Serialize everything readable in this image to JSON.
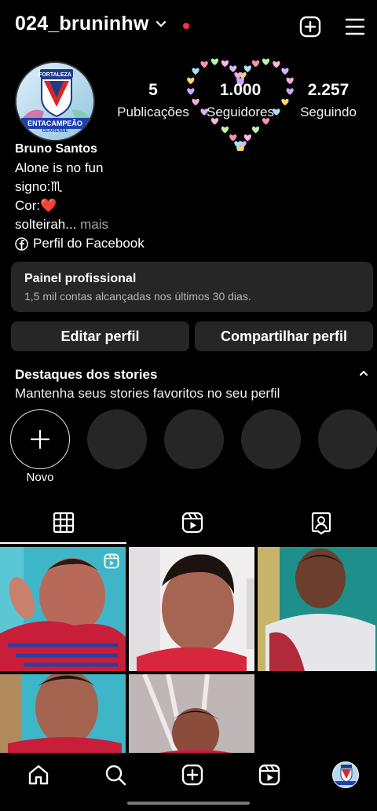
{
  "header": {
    "username": "024_bruninhw"
  },
  "avatar": {
    "badge_top_text": "FORTALEZA",
    "badge_bottom_text": "ENTACAMPEÃO",
    "badge_sub_text": "CEARENSE"
  },
  "stats": [
    {
      "value": "5",
      "label": "Publicações"
    },
    {
      "value": "1.000",
      "label": "Seguidores"
    },
    {
      "value": "2.257",
      "label": "Seguindo"
    }
  ],
  "bio": {
    "name": "Bruno Santos",
    "line1": "Alone is no fun",
    "line2": "signo:♏",
    "line3": "Cor:❤️",
    "line4": "solteirah...",
    "more": " mais",
    "facebook_link": "Perfil do Facebook"
  },
  "pro_panel": {
    "title": "Painel profissional",
    "subtitle": "1,5 mil contas alcançadas nos últimos 30 dias."
  },
  "buttons": {
    "edit": "Editar perfil",
    "share": "Compartilhar perfil"
  },
  "highlights": {
    "title": "Destaques dos stories",
    "subtitle": "Mantenha seus stories favoritos no seu perfil",
    "new_label": "Novo"
  },
  "colors": {
    "background": "#000000",
    "surface": "#262626",
    "accent_red": "#ff3040",
    "muted_text": "#a8a8a8"
  }
}
